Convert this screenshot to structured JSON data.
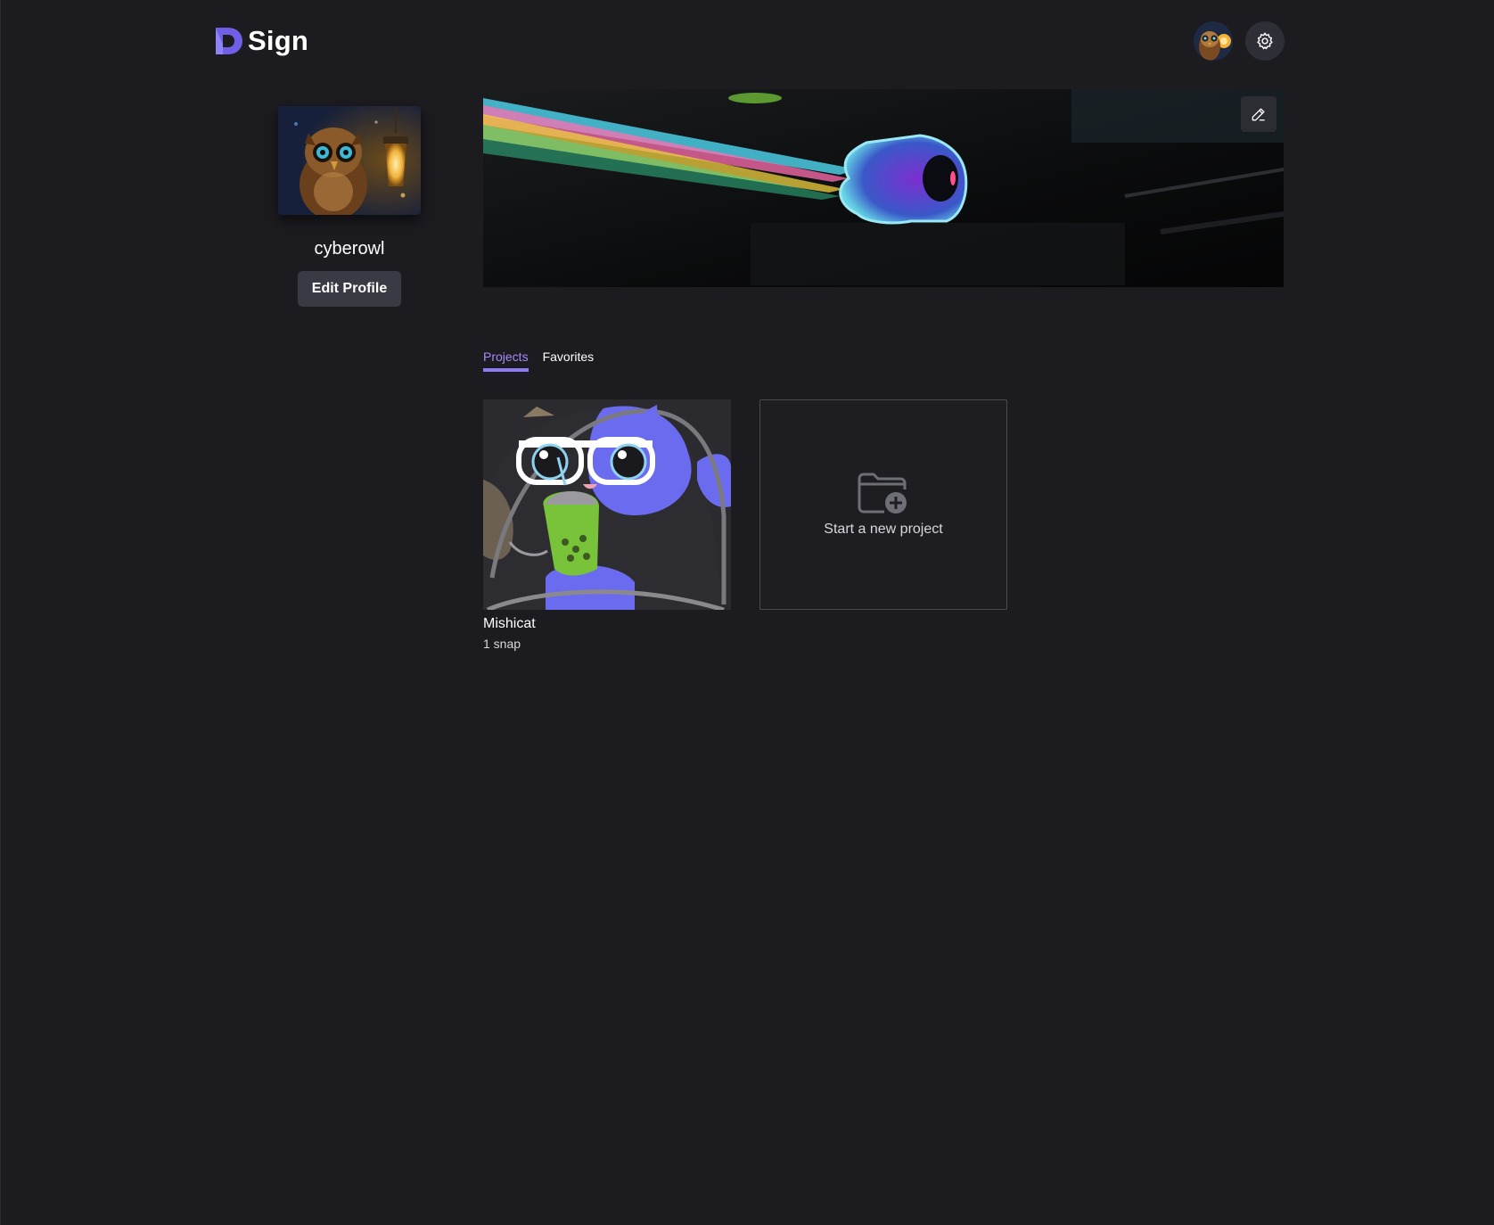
{
  "app": {
    "logo_text": "Sign",
    "brand_color": "#7c6cf0"
  },
  "header": {
    "avatar_icon": "owl-avatar",
    "settings_icon": "gear-icon"
  },
  "profile": {
    "username": "cyberowl",
    "edit_profile_label": "Edit Profile",
    "banner_edit_icon": "pencil-icon"
  },
  "tabs": [
    {
      "label": "Projects",
      "active": true
    },
    {
      "label": "Favorites",
      "active": false
    }
  ],
  "projects": [
    {
      "title": "Mishicat",
      "subtitle": "1 snap"
    }
  ],
  "new_project": {
    "label": "Start a new project",
    "icon": "folder-plus-icon"
  },
  "colors": {
    "background": "#1b1b20",
    "accent": "#a78bfa",
    "button_bg": "#3a3a44"
  }
}
